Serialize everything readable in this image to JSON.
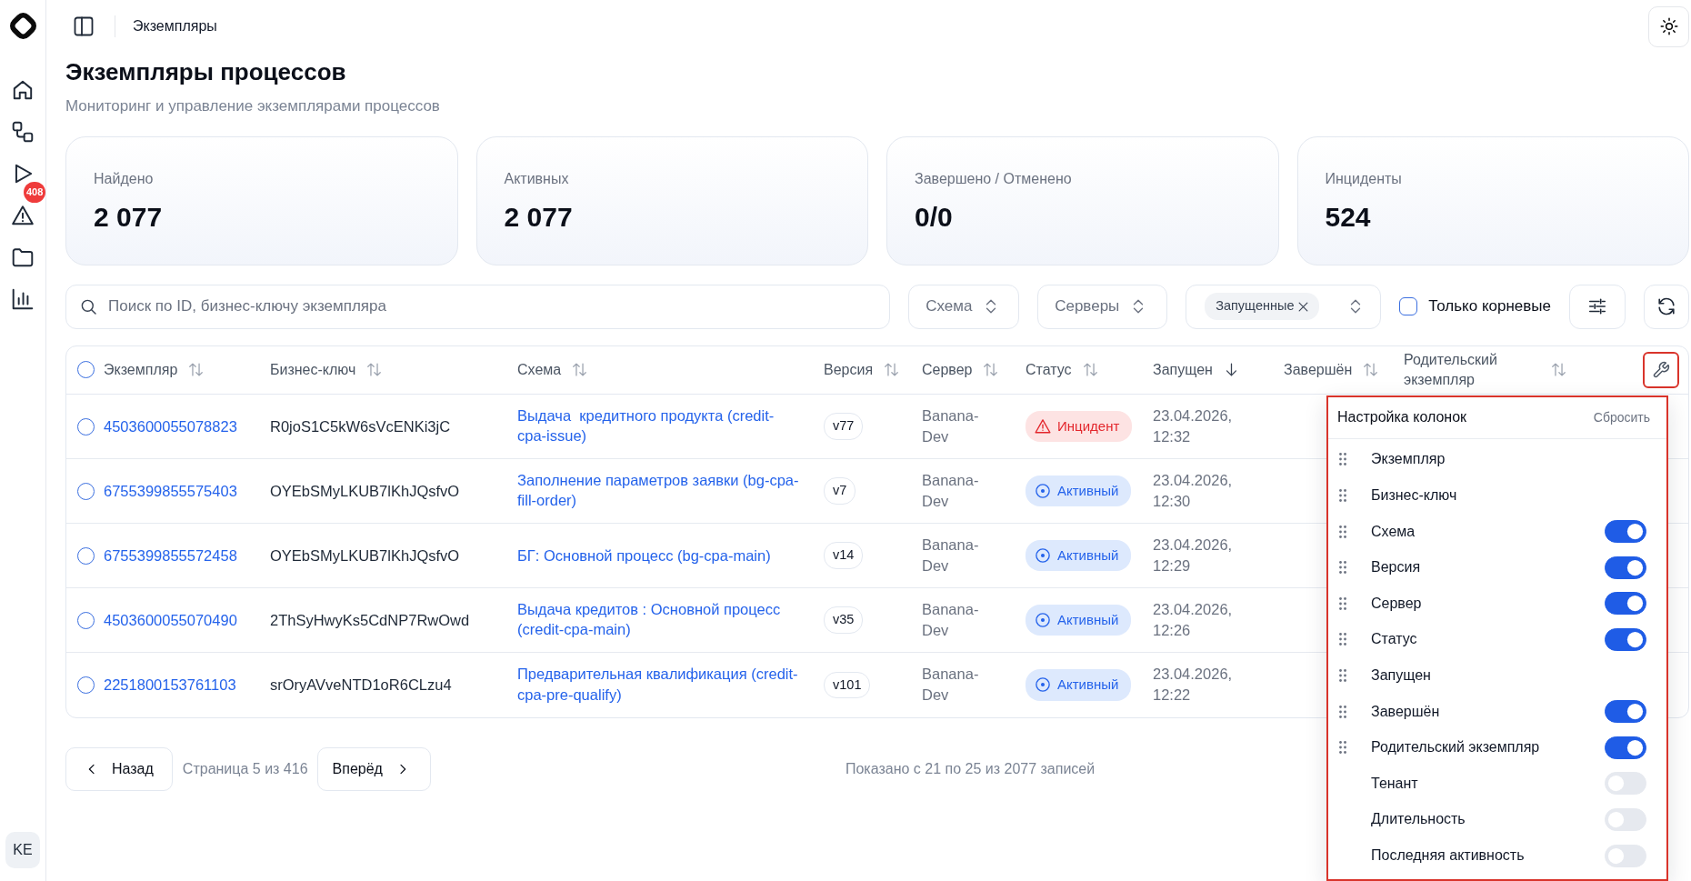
{
  "sidebar": {
    "alerts_badge": "408",
    "user_initials": "KE"
  },
  "header": {
    "breadcrumb": "Экземпляры"
  },
  "page": {
    "title": "Экземпляры процессов",
    "subtitle": "Мониторинг и управление экземплярами процессов"
  },
  "stats": [
    {
      "label": "Найдено",
      "value": "2 077"
    },
    {
      "label": "Активных",
      "value": "2 077"
    },
    {
      "label": "Завершено / Отменено",
      "value": "0/0"
    },
    {
      "label": "Инциденты",
      "value": "524"
    }
  ],
  "filters": {
    "search": {
      "placeholder": "Поиск по ID, бизнес-ключу экземпляра"
    },
    "dropdowns": [
      {
        "placeholder": "Схема"
      },
      {
        "placeholder": "Серверы"
      }
    ],
    "status": {
      "chips": [
        "Запущенные"
      ]
    },
    "root_only": {
      "label": "Только корневые",
      "checked": false
    }
  },
  "table": {
    "all_selected": false,
    "columns": [
      {
        "label": "Экземпляр",
        "sorted": false
      },
      {
        "label": "Бизнес-ключ",
        "sorted": false
      },
      {
        "label": "Схема",
        "sorted": false
      },
      {
        "label": "Версия",
        "sorted": false
      },
      {
        "label": "Сервер",
        "sorted": false
      },
      {
        "label": "Статус",
        "sorted": false
      },
      {
        "label": "Запущен",
        "sorted": true
      },
      {
        "label": "Завершён",
        "sorted": false
      },
      {
        "label": "Родительский экземпляр",
        "sorted": false
      }
    ],
    "rows": [
      {
        "selected": false,
        "instance": "4503600055078823",
        "business_key": "R0joS1C5kW6sVcENKi3jC",
        "schema": "Выдача  кредитного продукта (credit-cpa-issue)",
        "version": "v77",
        "server": "Banana-Dev",
        "status": {
          "kind": "incident",
          "label": "Инцидент"
        },
        "started": "23.04.2026, 12:32"
      },
      {
        "selected": false,
        "instance": "6755399855575403",
        "business_key": "OYEbSMyLKUB7lKhJQsfvO",
        "schema": "Заполнение параметров заявки (bg-cpa-fill-order)",
        "version": "v7",
        "server": "Banana-Dev",
        "status": {
          "kind": "active",
          "label": "Активный"
        },
        "started": "23.04.2026, 12:30"
      },
      {
        "selected": false,
        "instance": "6755399855572458",
        "business_key": "OYEbSMyLKUB7lKhJQsfvO",
        "schema": "БГ: Основной процесс (bg-cpa-main)",
        "version": "v14",
        "server": "Banana-Dev",
        "status": {
          "kind": "active",
          "label": "Активный"
        },
        "started": "23.04.2026, 12:29"
      },
      {
        "selected": false,
        "instance": "4503600055070490",
        "business_key": "2ThSyHwyKs5CdNP7RwOwd",
        "schema": "Выдача кредитов : Основной процесс (credit-cpa-main)",
        "version": "v35",
        "server": "Banana-Dev",
        "status": {
          "kind": "active",
          "label": "Активный"
        },
        "started": "23.04.2026, 12:26"
      },
      {
        "selected": false,
        "instance": "2251800153761103",
        "business_key": "srOryAVveNTD1oR6CLzu4",
        "schema": "Предварительная квалификация (credit-cpa-pre-qualify)",
        "version": "v101",
        "server": "Banana-Dev",
        "status": {
          "kind": "active",
          "label": "Активный"
        },
        "started": "23.04.2026, 12:22"
      }
    ]
  },
  "column_settings": {
    "highlighted": true,
    "title": "Настройка колонок",
    "reset": "Сбросить",
    "items": [
      {
        "label": "Экземпляр",
        "draggable": true,
        "kind": "fixed"
      },
      {
        "label": "Бизнес-ключ",
        "draggable": true,
        "kind": "fixed"
      },
      {
        "label": "Схема",
        "draggable": true,
        "kind": "toggle",
        "on": true
      },
      {
        "label": "Версия",
        "draggable": true,
        "kind": "toggle",
        "on": true
      },
      {
        "label": "Сервер",
        "draggable": true,
        "kind": "toggle",
        "on": true
      },
      {
        "label": "Статус",
        "draggable": true,
        "kind": "toggle",
        "on": true
      },
      {
        "label": "Запущен",
        "draggable": true,
        "kind": "fixed"
      },
      {
        "label": "Завершён",
        "draggable": true,
        "kind": "toggle",
        "on": true
      },
      {
        "label": "Родительский экземпляр",
        "draggable": true,
        "kind": "toggle",
        "on": true
      },
      {
        "label": "Тенант",
        "draggable": false,
        "kind": "toggle",
        "on": false
      },
      {
        "label": "Длительность",
        "draggable": false,
        "kind": "toggle",
        "on": false
      },
      {
        "label": "Последняя активность",
        "draggable": false,
        "kind": "toggle",
        "on": false
      }
    ]
  },
  "pagination": {
    "prev": "Назад",
    "page_info": "Страница 5 из 416",
    "next": "Вперёд",
    "summary": "Показано с 21 по 25 из 2077 записей"
  }
}
